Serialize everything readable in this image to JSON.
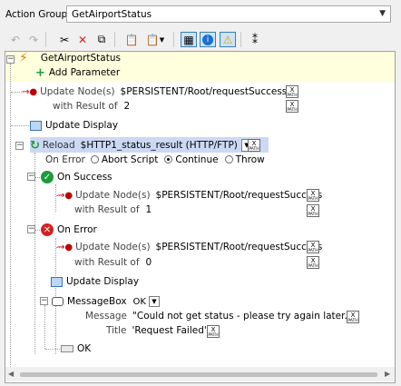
{
  "action_group": {
    "label": "Action Group:",
    "value": "GetAirportStatus"
  },
  "toolbar": {
    "undo_icon": "undo-icon",
    "redo_icon": "redo-icon",
    "cut_icon": "scissors-icon",
    "delete_icon": "red-x-icon",
    "copy_icon": "copy-icon",
    "paste_icon": "paste-icon",
    "paste_menu_icon": "paste-dropdown-icon",
    "view_list_icon": "list-view-icon",
    "info_icon": "info-icon",
    "warning_icon": "warning-icon",
    "debug_icon": "debug-icon"
  },
  "tree": {
    "root_name": "GetAirportStatus",
    "add_parameter": "Add Parameter",
    "update_node_1": {
      "label": "Update Node(s)",
      "path": "$PERSISTENT/Root/requestSuccess",
      "result_label": "with Result of",
      "result": "2"
    },
    "update_display_1": "Update Display",
    "reload": {
      "label": "Reload",
      "source": "$HTTP1_status_result (HTTP/FTP)",
      "on_error_label": "On Error",
      "opt_abort": "Abort Script",
      "opt_continue": "Continue",
      "opt_throw": "Throw"
    },
    "on_success": {
      "label": "On Success",
      "update_node": {
        "label": "Update Node(s)",
        "path": "$PERSISTENT/Root/requestSuccess",
        "result_label": "with Result of",
        "result": "1"
      }
    },
    "on_error": {
      "label": "On Error",
      "update_node": {
        "label": "Update Node(s)",
        "path": "$PERSISTENT/Root/requestSuccess",
        "result_label": "with Result of",
        "result": "0"
      },
      "update_display": "Update Display",
      "messagebox": {
        "label": "MessageBox",
        "button_value": "OK",
        "message_label": "Message",
        "message": "\"Could not get status - please try again later.\"",
        "title_label": "Title",
        "title": "'Request Failed'",
        "ok_label": "OK"
      }
    },
    "xpath_label": "X",
    "xpath_sub": "PATH"
  },
  "colors": {
    "selection": "#ccd9f4",
    "header_band": "#ffffdd",
    "success": "#1e9a3b",
    "error": "#d62020"
  }
}
